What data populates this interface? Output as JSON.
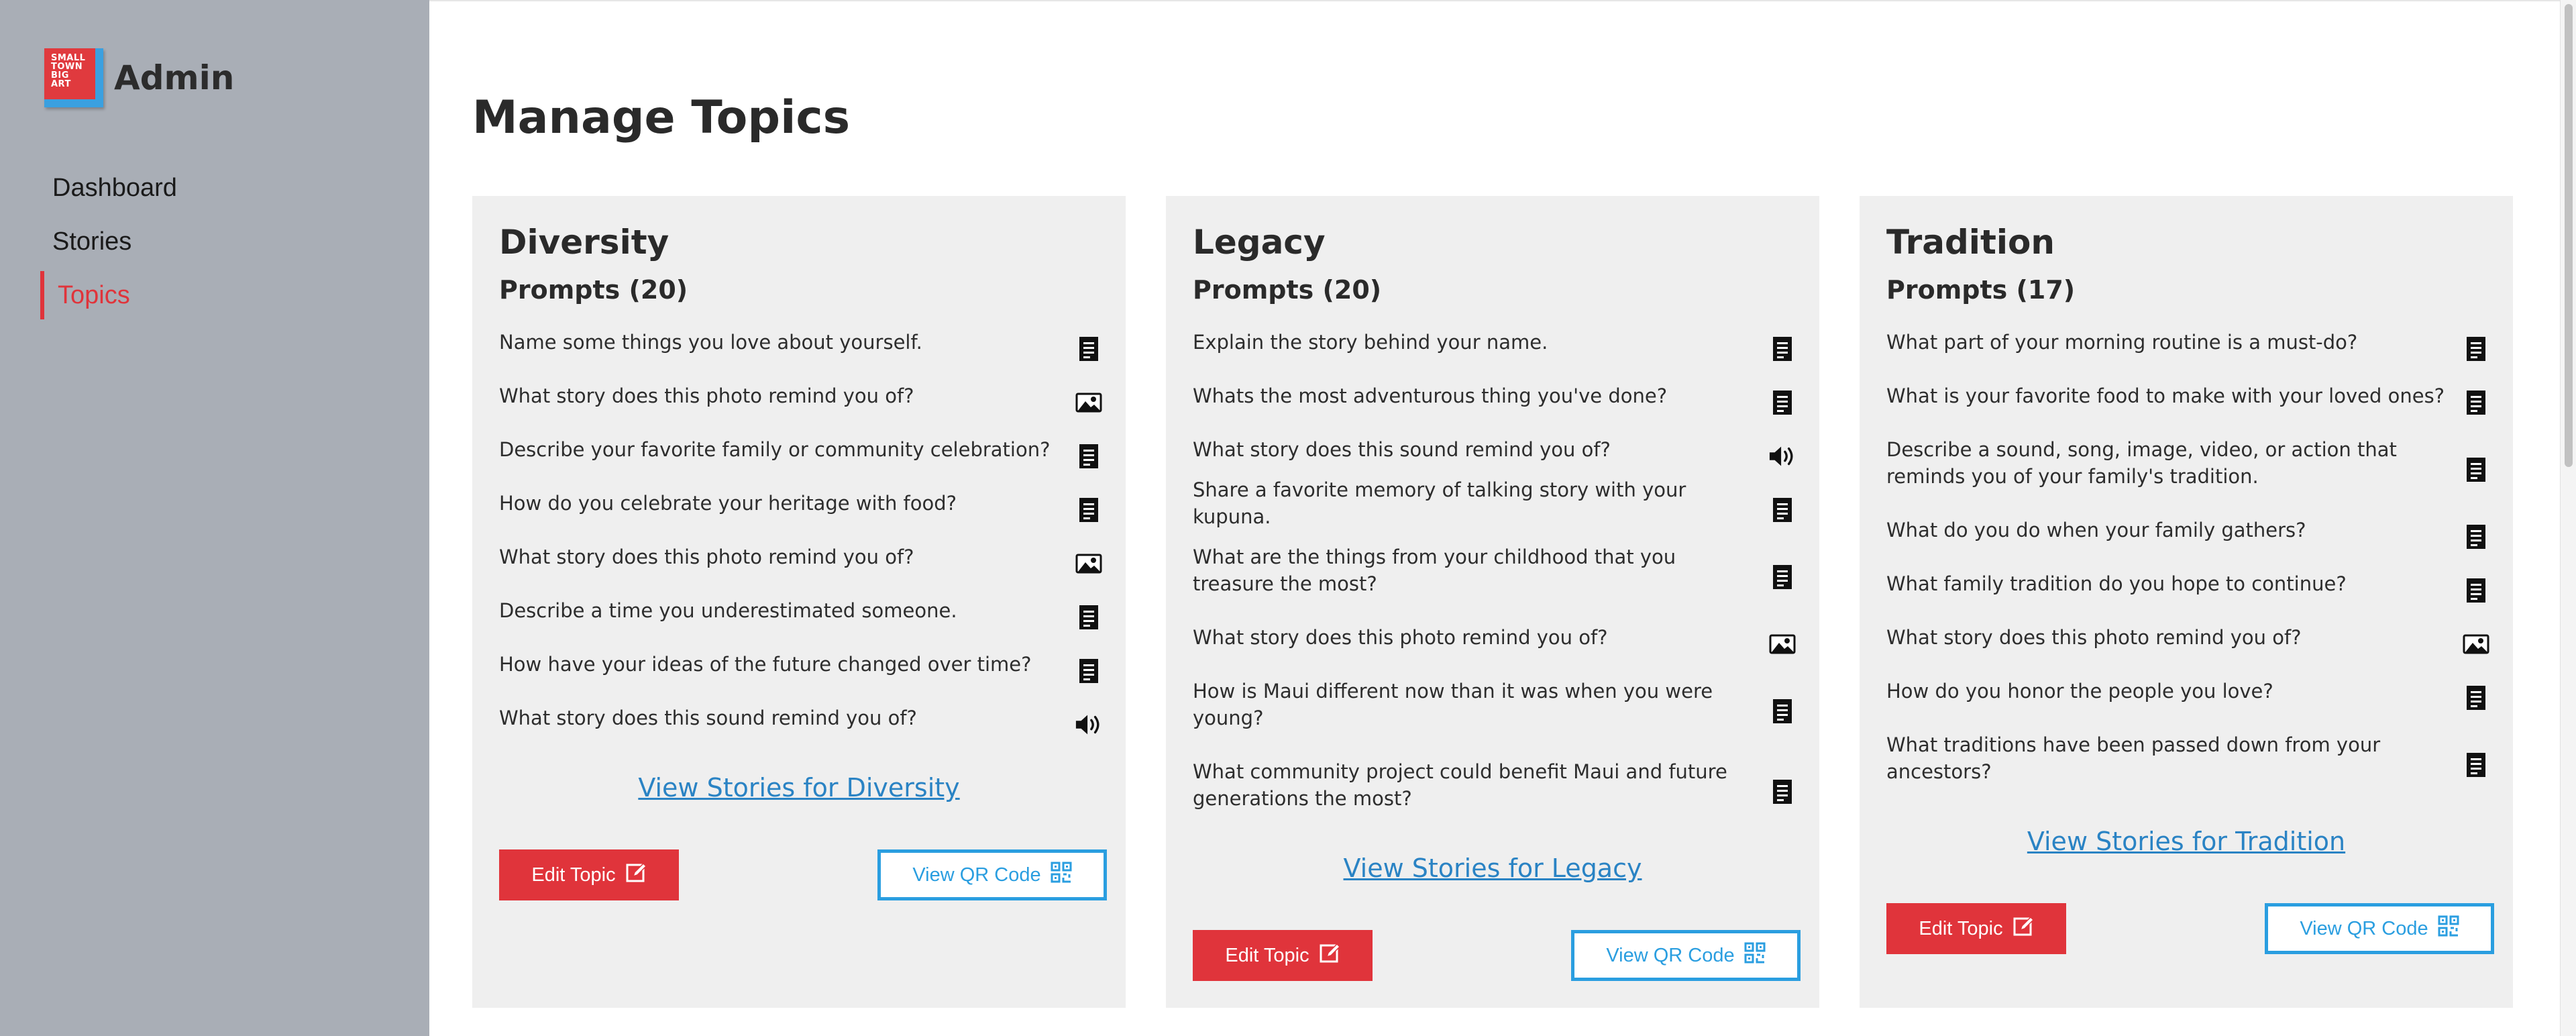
{
  "brand": {
    "logo_lines": [
      "SMALL",
      "TOWN",
      "BIG",
      "ART"
    ],
    "title": "Admin"
  },
  "nav": [
    {
      "label": "Dashboard",
      "active": false
    },
    {
      "label": "Stories",
      "active": false
    },
    {
      "label": "Topics",
      "active": true
    }
  ],
  "page_title": "Manage Topics",
  "colors": {
    "accent_red": "#e0343b",
    "accent_blue": "#2a9ee0",
    "link_blue": "#2a83c4",
    "sidebar": "#a9aeb6",
    "card": "#efefef"
  },
  "cards": [
    {
      "title": "Diversity",
      "prompts_label": "Prompts (20)",
      "prompts": [
        {
          "text": "Name some things you love about yourself.",
          "icon": "text-document-icon"
        },
        {
          "text": "What story does this photo remind you of?",
          "icon": "photo-icon"
        },
        {
          "text": "Describe your favorite family or community celebration?",
          "icon": "text-document-icon"
        },
        {
          "text": "How do you celebrate your heritage with food?",
          "icon": "text-document-icon"
        },
        {
          "text": "What story does this photo remind you of?",
          "icon": "photo-icon"
        },
        {
          "text": "Describe a time you underestimated someone.",
          "icon": "text-document-icon"
        },
        {
          "text": "How have your ideas of the future changed over time?",
          "icon": "text-document-icon"
        },
        {
          "text": "What story does this sound remind you of?",
          "icon": "speaker-icon"
        }
      ],
      "view_link": "View Stories for Diversity",
      "edit_label": "Edit Topic",
      "qr_label": "View QR Code"
    },
    {
      "title": "Legacy",
      "prompts_label": "Prompts (20)",
      "prompts": [
        {
          "text": "Explain the story behind your name.",
          "icon": "text-document-icon"
        },
        {
          "text": "Whats the most adventurous thing you've done?",
          "icon": "text-document-icon"
        },
        {
          "text": "What story does this sound remind you of?",
          "icon": "speaker-icon"
        },
        {
          "text": "Share a favorite memory of talking story with your kupuna.",
          "icon": "text-document-icon"
        },
        {
          "text": "What are the things from your childhood that you treasure the most?",
          "icon": "text-document-icon"
        },
        {
          "text": "What story does this photo remind you of?",
          "icon": "photo-icon"
        },
        {
          "text": "How is Maui different now than it was when you were young?",
          "icon": "text-document-icon"
        },
        {
          "text": "What community project could benefit Maui and future generations the most?",
          "icon": "text-document-icon"
        }
      ],
      "view_link": "View Stories for Legacy",
      "edit_label": "Edit Topic",
      "qr_label": "View QR Code"
    },
    {
      "title": "Tradition",
      "prompts_label": "Prompts (17)",
      "prompts": [
        {
          "text": "What part of your morning routine is a must-do?",
          "icon": "text-document-icon"
        },
        {
          "text": "What is your favorite food to make with your loved ones?",
          "icon": "text-document-icon"
        },
        {
          "text": "Describe a sound, song, image, video, or action that reminds you of your family's tradition.",
          "icon": "text-document-icon"
        },
        {
          "text": "What do you do when your family gathers?",
          "icon": "text-document-icon"
        },
        {
          "text": "What family tradition do you hope to continue?",
          "icon": "text-document-icon"
        },
        {
          "text": "What story does this photo remind you of?",
          "icon": "photo-icon"
        },
        {
          "text": "How do you honor the people you love?",
          "icon": "text-document-icon"
        },
        {
          "text": "What traditions have been passed down from your ancestors?",
          "icon": "text-document-icon"
        }
      ],
      "view_link": "View Stories for Tradition",
      "edit_label": "Edit Topic",
      "qr_label": "View QR Code"
    }
  ]
}
